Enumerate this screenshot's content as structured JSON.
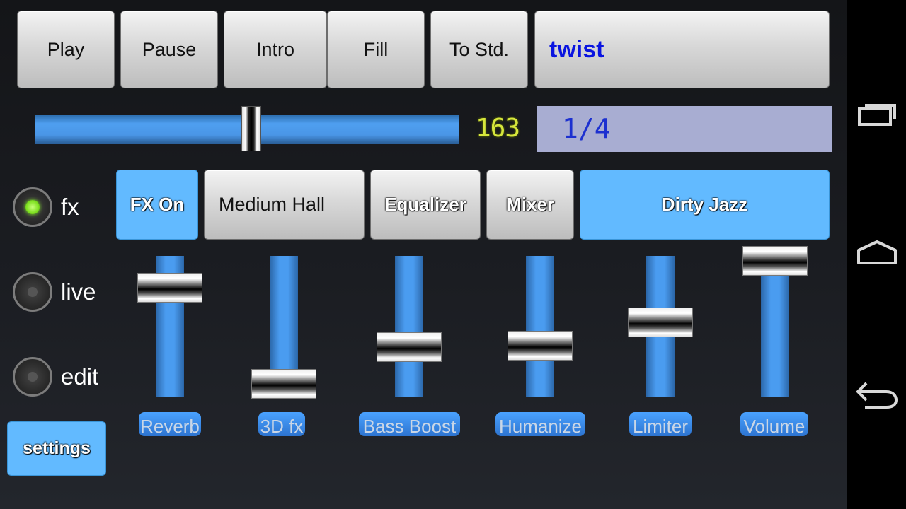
{
  "transport": {
    "play_label": "Play",
    "pause_label": "Pause",
    "intro_label": "Intro",
    "fill_label": "Fill",
    "to_std_label": "To Std.",
    "song_name": "twist"
  },
  "tempo": {
    "value": "163",
    "slider_fraction": 0.51,
    "time_signature": "1/4"
  },
  "modes": [
    {
      "label": "fx",
      "selected": true
    },
    {
      "label": "live",
      "selected": false
    },
    {
      "label": "edit",
      "selected": false
    }
  ],
  "settings_label": "settings",
  "fx_bar": {
    "fx_on_label": "FX On",
    "reverb_preset": "Medium Hall",
    "equalizer_label": "Equalizer",
    "mixer_label": "Mixer",
    "style_preset": "Dirty Jazz"
  },
  "faders": [
    {
      "label": "Reverb",
      "level": 0.78
    },
    {
      "label": "3D fx",
      "level": 0.0
    },
    {
      "label": "Bass Boost",
      "level": 0.3
    },
    {
      "label": "Humanize",
      "level": 0.31
    },
    {
      "label": "Limiter",
      "level": 0.5
    },
    {
      "label": "Volume",
      "level": 1.0
    }
  ],
  "colors": {
    "accent_blue": "#62baff",
    "song_text": "#0a14e0",
    "tempo_led": "#d6e63c",
    "signature_bg": "#a8add2",
    "mode_on": "#7ee020"
  },
  "nav": {
    "recents_icon": "recent-apps-icon",
    "home_icon": "home-icon",
    "back_icon": "back-icon"
  }
}
